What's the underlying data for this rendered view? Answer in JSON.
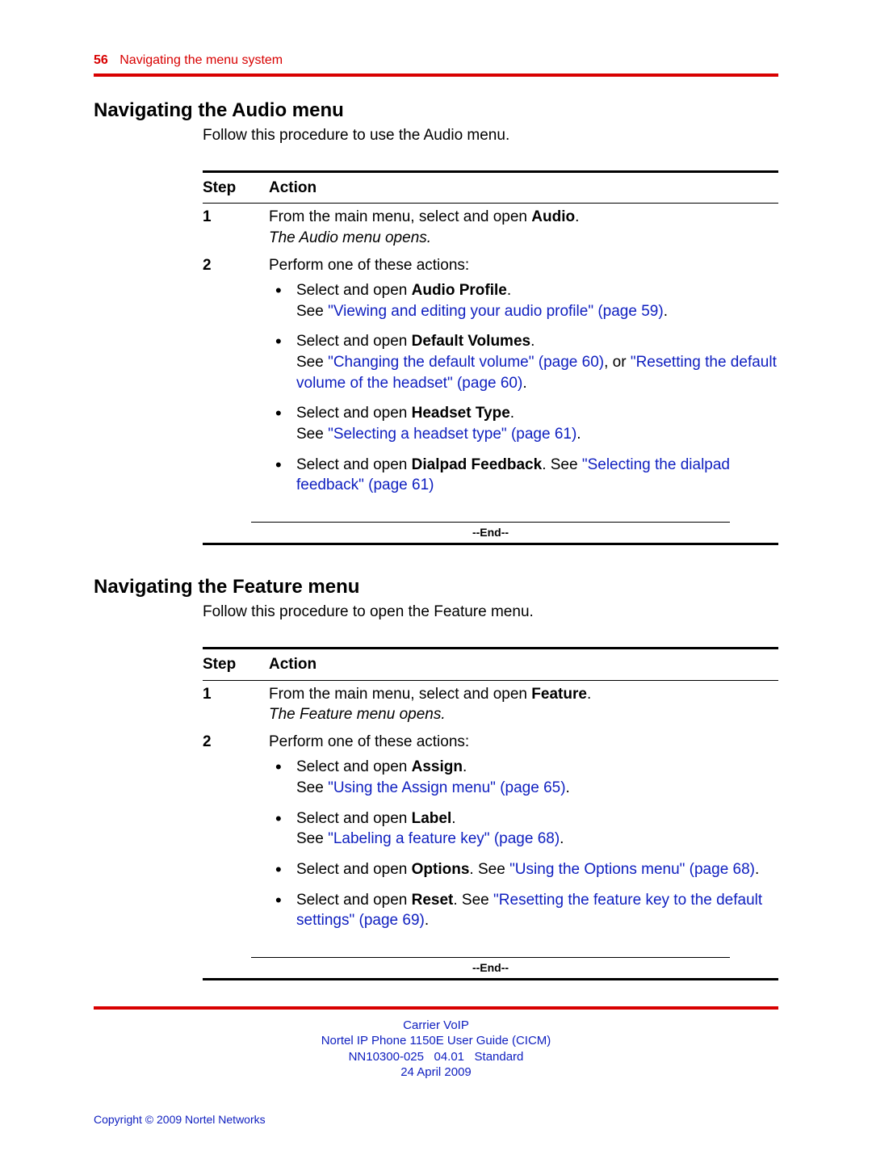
{
  "header": {
    "page_number": "56",
    "section_title": "Navigating the menu system"
  },
  "sections": [
    {
      "heading": "Navigating the Audio menu",
      "intro": "Follow this procedure to use the Audio menu.",
      "th_step": "Step",
      "th_action": "Action",
      "steps": [
        {
          "num": "1",
          "line_a": "From the main menu, select and open ",
          "line_a_bold": "Audio",
          "line_a_tail": ".",
          "line_b_italic": "The Audio menu opens."
        },
        {
          "num": "2",
          "line_a": "Perform one of these actions:",
          "bullets": [
            {
              "pre": "Select and open ",
              "bold": "Audio Profile",
              "post": ".",
              "see": "See ",
              "links": [
                "\"Viewing and editing your audio profile\" (page 59)"
              ],
              "tail": "."
            },
            {
              "pre": "Select and open ",
              "bold": "Default Volumes",
              "post": ".",
              "see": "See ",
              "links": [
                "\"Changing the default volume\" (page 60)"
              ],
              "mid": ", or ",
              "links2": [
                "\"Resetting the default volume of the headset\" (page 60)"
              ],
              "tail": "."
            },
            {
              "pre": "Select and open ",
              "bold": "Headset Type",
              "post": ".",
              "see": "See ",
              "links": [
                "\"Selecting a headset type\" (page 61)"
              ],
              "tail": "."
            },
            {
              "pre": "Select and open ",
              "bold": "Dialpad Feedback",
              "post": ". See ",
              "links": [
                "\"Selecting the dialpad feedback\" (page 61)"
              ],
              "tail": ""
            }
          ]
        }
      ],
      "end": "--End--"
    },
    {
      "heading": "Navigating the Feature menu",
      "intro": "Follow this procedure to open the Feature menu.",
      "th_step": "Step",
      "th_action": "Action",
      "steps": [
        {
          "num": "1",
          "line_a": "From the main menu, select and open ",
          "line_a_bold": "Feature",
          "line_a_tail": ".",
          "line_b_italic": "The Feature menu opens."
        },
        {
          "num": "2",
          "line_a": "Perform one of these actions:",
          "bullets": [
            {
              "pre": "Select and open ",
              "bold": "Assign",
              "post": ".",
              "see": "See ",
              "links": [
                "\"Using the Assign menu\" (page 65)"
              ],
              "tail": "."
            },
            {
              "pre": "Select and open ",
              "bold": "Label",
              "post": ".",
              "see": "See ",
              "links": [
                "\"Labeling a feature key\" (page 68)"
              ],
              "tail": "."
            },
            {
              "pre": "Select and open ",
              "bold": "Options",
              "post": ". See ",
              "links": [
                "\"Using the Options menu\" (page 68)"
              ],
              "tail": "."
            },
            {
              "pre": "Select and open ",
              "bold": "Reset",
              "post": ". See ",
              "links": [
                "\"Resetting the feature key to the default settings\" (page 69)"
              ],
              "tail": "."
            }
          ]
        }
      ],
      "end": "--End--"
    }
  ],
  "footer": {
    "line1": "Carrier VoIP",
    "line2": "Nortel IP Phone 1150E User Guide (CICM)",
    "line3": "NN10300-025   04.01   Standard",
    "line4": "24 April 2009",
    "copyright": "Copyright © 2009 Nortel Networks"
  }
}
